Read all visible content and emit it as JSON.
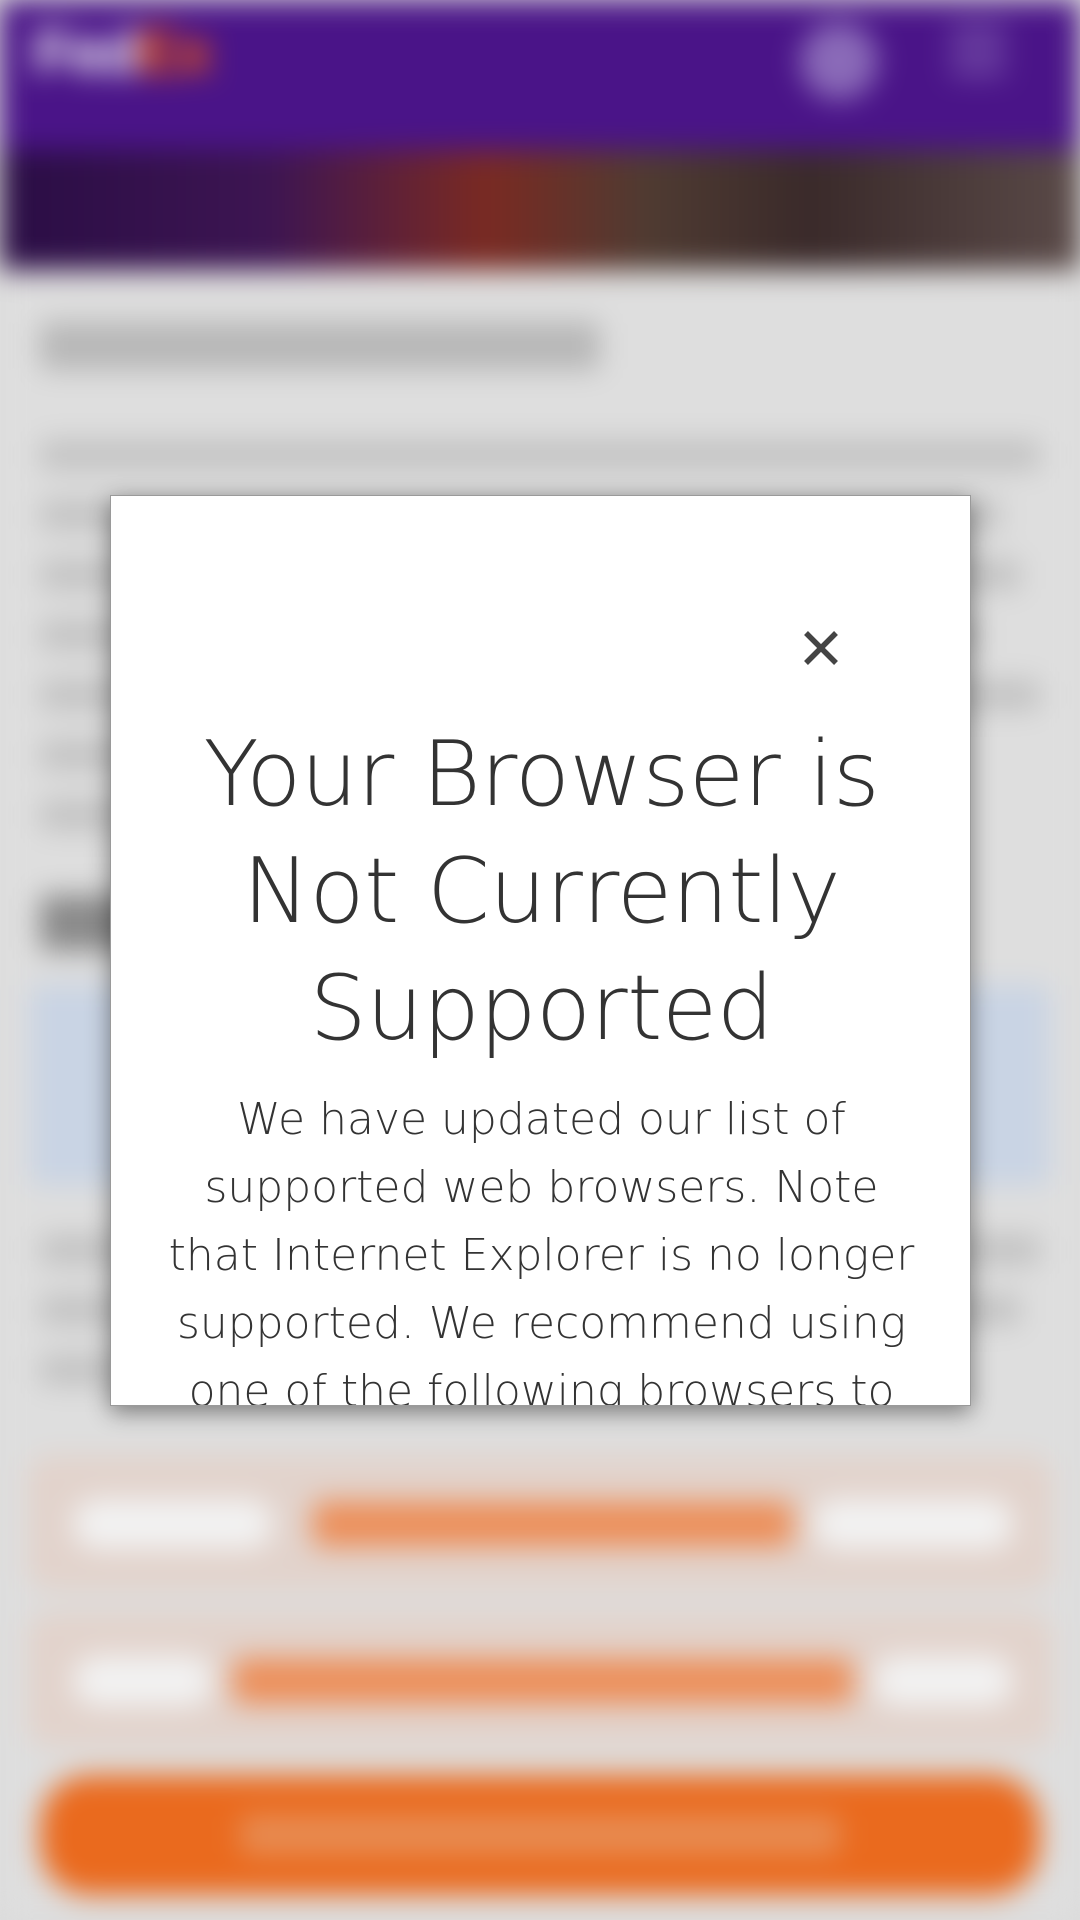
{
  "header": {
    "logo_part1": "Fed",
    "logo_part2": "Ex"
  },
  "modal": {
    "close_icon": "close-icon",
    "title": "Your Browser is Not Currently Supported",
    "body": "We have updated our list of supported web browsers. Note that Internet Explorer is no longer supported. We recommend using one of the following browsers to"
  },
  "colors": {
    "header_purple": "#4d148c",
    "accent_orange": "#ff6200",
    "modal_text": "#333333"
  }
}
